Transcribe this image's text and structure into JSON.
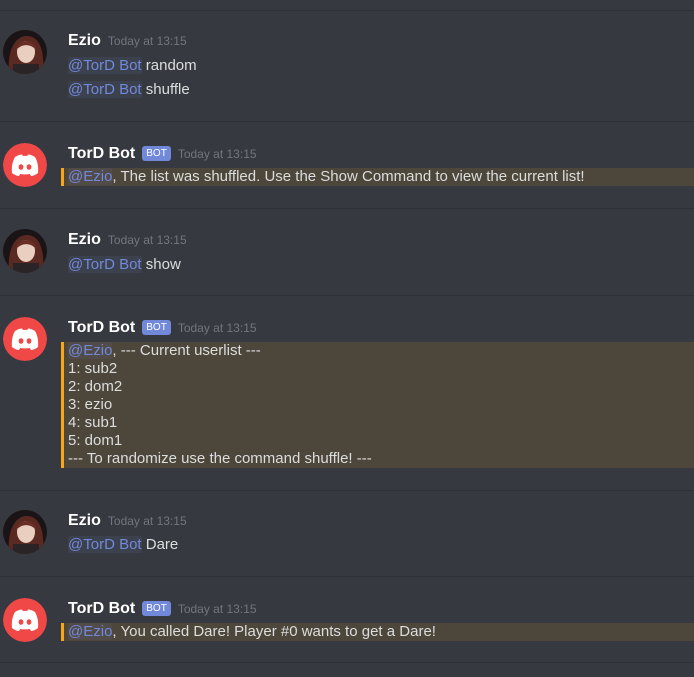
{
  "colors": {
    "background": "#36393f",
    "mention": "#7289da",
    "highlight_border": "#faa61a",
    "bot_tag": "#7289da"
  },
  "messages": [
    {
      "author": "Ezio",
      "timestamp": "Today at 13:15",
      "lines": [
        {
          "mention": "@TorD Bot",
          "text": " random"
        },
        {
          "mention": "@TorD Bot",
          "text": " shuffle"
        }
      ]
    },
    {
      "author": "TorD Bot",
      "bot_tag": "BOT",
      "timestamp": "Today at 13:15",
      "lines": [
        {
          "mention": "@Ezio",
          "text": ", The list was shuffled. Use the Show Command to view the current list!"
        }
      ]
    },
    {
      "author": "Ezio",
      "timestamp": "Today at 13:15",
      "lines": [
        {
          "mention": "@TorD Bot",
          "text": " show"
        }
      ]
    },
    {
      "author": "TorD Bot",
      "bot_tag": "BOT",
      "timestamp": "Today at 13:15",
      "lines": [
        {
          "mention": "@Ezio",
          "text": ", --- Current userlist ---"
        },
        {
          "text": "1: sub2"
        },
        {
          "text": "2: dom2"
        },
        {
          "text": "3: ezio"
        },
        {
          "text": "4: sub1"
        },
        {
          "text": "5: dom1"
        },
        {
          "text": "--- To randomize use the command shuffle! ---"
        }
      ]
    },
    {
      "author": "Ezio",
      "timestamp": "Today at 13:15",
      "lines": [
        {
          "mention": "@TorD Bot",
          "text": " Dare"
        }
      ]
    },
    {
      "author": "TorD Bot",
      "bot_tag": "BOT",
      "timestamp": "Today at 13:15",
      "lines": [
        {
          "mention": "@Ezio",
          "text": ", You called Dare! Player #0 wants to get a Dare!"
        }
      ]
    }
  ]
}
